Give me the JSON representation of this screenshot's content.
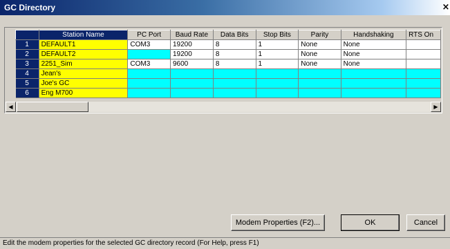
{
  "window": {
    "title": "GC Directory",
    "close_glyph": "×"
  },
  "grid": {
    "columns": [
      "Station Name",
      "PC Port",
      "Baud Rate",
      "Data Bits",
      "Stop Bits",
      "Parity",
      "Handshaking",
      "RTS On"
    ],
    "rows": [
      {
        "num": "1",
        "cells": [
          "DEFAULT1",
          "COM3",
          "19200",
          "8",
          "1",
          "None",
          "None",
          ""
        ]
      },
      {
        "num": "2",
        "cells": [
          "DEFAULT2",
          "",
          "19200",
          "8",
          "1",
          "None",
          "None",
          ""
        ]
      },
      {
        "num": "3",
        "cells": [
          "2251_Sim",
          "COM3",
          "9600",
          "8",
          "1",
          "None",
          "None",
          ""
        ]
      },
      {
        "num": "4",
        "cells": [
          "Jean's",
          "",
          "",
          "",
          "",
          "",
          "",
          ""
        ]
      },
      {
        "num": "5",
        "cells": [
          "Joe's GC",
          "",
          "",
          "",
          "",
          "",
          "",
          ""
        ]
      },
      {
        "num": "6",
        "cells": [
          "Eng M700",
          "",
          "",
          "",
          "",
          "",
          "",
          ""
        ]
      }
    ],
    "scroll_left_glyph": "◀",
    "scroll_right_glyph": "▶"
  },
  "buttons": {
    "modem_properties": "Modem Properties (F2)...",
    "ok": "OK",
    "cancel": "Cancel"
  },
  "statusbar": {
    "text": "Edit the modem properties for the selected GC directory record (For Help, press F1)"
  },
  "colors": {
    "name_cell": "#ffff00",
    "empty_record_cell": "#00ffff",
    "selection": "#0a246a"
  }
}
